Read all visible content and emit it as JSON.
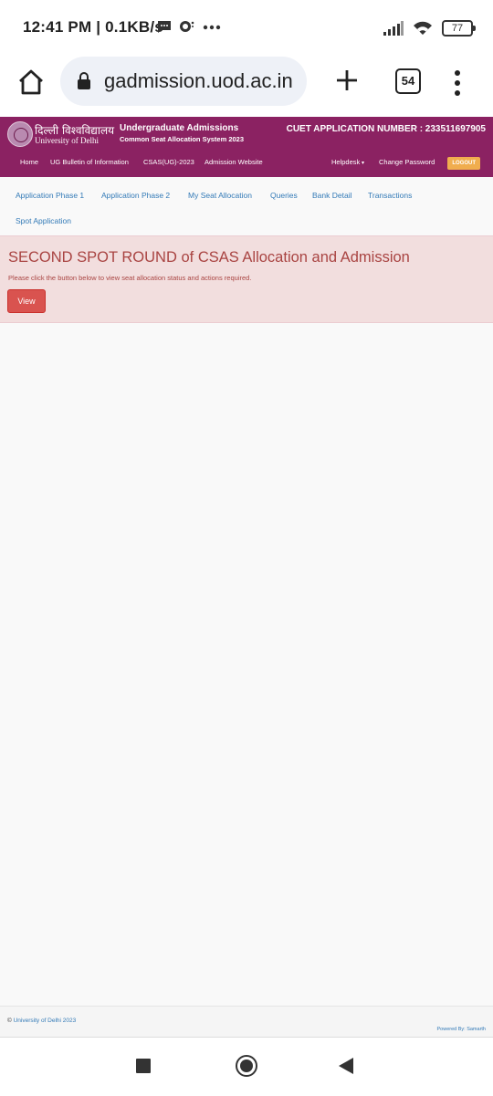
{
  "status_bar": {
    "time": "12:41 PM",
    "speed": "| 0.1KB/s",
    "battery": "77"
  },
  "browser": {
    "url": "gadmission.uod.ac.in",
    "tab_count": "54"
  },
  "site_header": {
    "university_hindi": "दिल्ली विश्वविद्यालय",
    "university_english": "University of Delhi",
    "title": "Undergraduate Admissions",
    "subtitle": "Common Seat Allocation System 2023",
    "cuet_label": "CUET APPLICATION NUMBER : 233511697905"
  },
  "nav": {
    "home": "Home",
    "bulletin": "UG Bulletin of Information",
    "csas": "CSAS(UG)-2023",
    "admission_website": "Admission Website",
    "helpdesk": "Helpdesk",
    "change_password": "Change Password",
    "logout": "LOGOUT"
  },
  "tabs": [
    "Application Phase 1",
    "Application Phase 2",
    "My Seat Allocation",
    "Queries",
    "Bank Detail",
    "Transactions",
    "Spot Application"
  ],
  "alert": {
    "heading": "SECOND SPOT ROUND of CSAS Allocation and Admission",
    "message": "Please click the button below to view seat allocation status and actions required.",
    "button": "View"
  },
  "footer": {
    "copyright_symbol": "©",
    "copyright_link": "University of Delhi 2023",
    "powered_by": "Powered By: Samarth"
  },
  "colors": {
    "header_bg": "#8b2262",
    "link": "#337ab7",
    "alert_bg": "#f2dede",
    "alert_text": "#a94442",
    "danger_button": "#d9534f",
    "logout_button": "#f0ad4e"
  }
}
